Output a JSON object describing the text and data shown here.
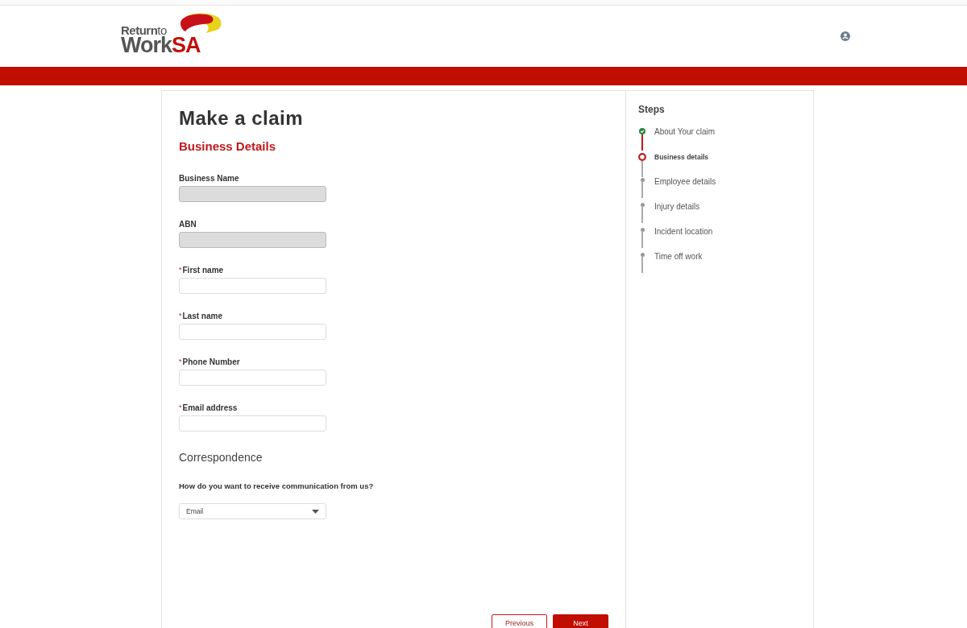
{
  "header": {
    "logo": {
      "word_1": "Return",
      "word_2": "to",
      "word_3": "Work",
      "word_4": "SA"
    }
  },
  "form": {
    "title": "Make a claim",
    "section": "Business Details",
    "fields": [
      {
        "label": "Business Name",
        "required": false,
        "disabled": true
      },
      {
        "label": "ABN",
        "required": false,
        "disabled": true
      },
      {
        "label": "First name",
        "required": true,
        "disabled": false
      },
      {
        "label": "Last name",
        "required": true,
        "disabled": false
      },
      {
        "label": "Phone Number",
        "required": true,
        "disabled": false
      },
      {
        "label": "Email address",
        "required": true,
        "disabled": false
      }
    ],
    "required_mark": "*",
    "correspondence": {
      "heading": "Correspondence",
      "question": "How do you want to receive communication from us?",
      "value": "Email"
    },
    "buttons": [
      {
        "label": "Previous",
        "kind": "secondary"
      },
      {
        "label": "Next",
        "kind": "primary"
      }
    ]
  },
  "steps": {
    "title": "Steps",
    "items": [
      {
        "label": "About Your claim",
        "kind": "complete"
      },
      {
        "label": "Business details",
        "kind": "current"
      },
      {
        "label": "Employee details",
        "kind": "pending"
      },
      {
        "label": "Injury details",
        "kind": "pending"
      },
      {
        "label": "Incident location",
        "kind": "pending"
      },
      {
        "label": "Time off work",
        "kind": "pending"
      }
    ]
  }
}
